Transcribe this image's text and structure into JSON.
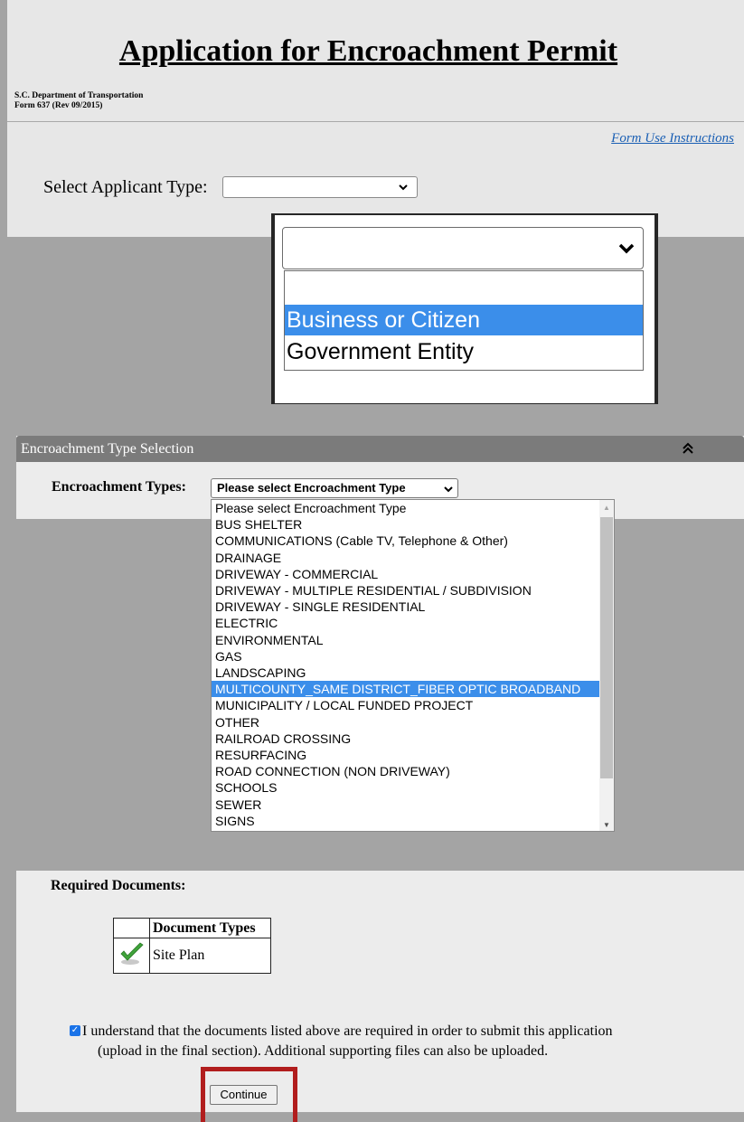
{
  "header": {
    "title": "Application for Encroachment Permit",
    "department": "S.C. Department of Transportation",
    "form_number": "Form 637 (Rev 09/2015)",
    "instructions_link": "Form Use Instructions"
  },
  "applicant": {
    "label": "Select Applicant Type:",
    "selected_value": "",
    "options": [
      "",
      "Business or Citizen",
      "Government Entity"
    ],
    "highlighted_option": "Business or Citizen"
  },
  "encroachment": {
    "section_title": "Encroachment Type Selection",
    "label": "Encroachment Types:",
    "selected_value": "Please select Encroachment Type",
    "options": [
      "Please select Encroachment Type",
      "BUS SHELTER",
      "COMMUNICATIONS (Cable TV, Telephone & Other)",
      "DRAINAGE",
      "DRIVEWAY - COMMERCIAL",
      "DRIVEWAY - MULTIPLE RESIDENTIAL / SUBDIVISION",
      "DRIVEWAY - SINGLE RESIDENTIAL",
      "ELECTRIC",
      "ENVIRONMENTAL",
      "GAS",
      "LANDSCAPING",
      "MULTICOUNTY_SAME DISTRICT_FIBER OPTIC BROADBAND",
      "MUNICIPALITY / LOCAL FUNDED PROJECT",
      "OTHER",
      "RAILROAD CROSSING",
      "RESURFACING",
      "ROAD CONNECTION (NON DRIVEWAY)",
      "SCHOOLS",
      "SEWER",
      "SIGNS"
    ],
    "highlighted_option": "MULTICOUNTY_SAME DISTRICT_FIBER OPTIC BROADBAND"
  },
  "documents": {
    "heading": "Required Documents:",
    "column_header": "Document Types",
    "rows": [
      {
        "name": "Site Plan",
        "status_icon": "checkmark-icon"
      }
    ]
  },
  "agreement": {
    "checked": true,
    "line1": "I understand that the documents listed above are required in order to submit this application",
    "line2": "(upload in the final section). Additional supporting files can also be uploaded."
  },
  "actions": {
    "continue_label": "Continue"
  },
  "colors": {
    "highlight": "#3b8eea",
    "link": "#1a5fb4",
    "annotation_border": "#b11d1d"
  }
}
